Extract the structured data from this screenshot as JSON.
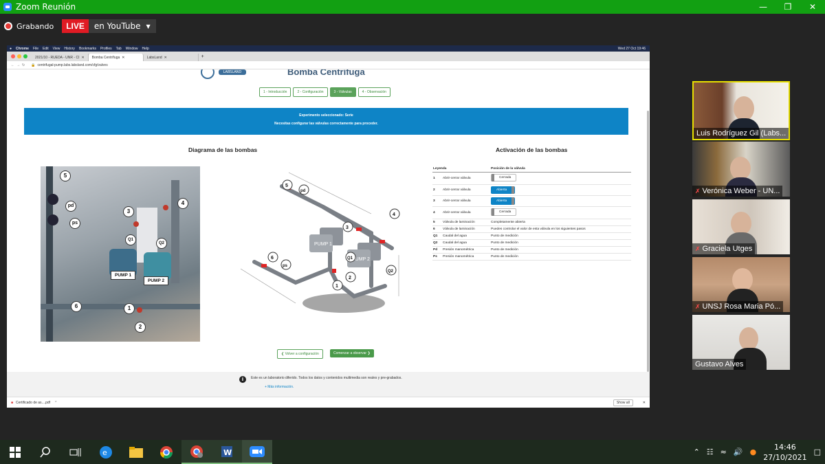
{
  "zoom": {
    "window_title": "Zoom Reunión",
    "recording_label": "Grabando",
    "live_label": "LIVE",
    "stream_target": "en YouTube"
  },
  "shared_screen": {
    "mac_menu": [
      "Chrome",
      "File",
      "Edit",
      "View",
      "History",
      "Bookmarks",
      "Profiles",
      "Tab",
      "Window",
      "Help"
    ],
    "mac_clock": "Wed 27 Oct 19:46",
    "tabs": [
      "2021/10 - RUEDA - UNR - CI",
      "Bomba Centrífuga",
      "LabsLand"
    ],
    "url": "centrifugal-pump.labs.labsland.com/cfg/valves",
    "page_title": "Bomba Centrífuga",
    "logo_badge": "LABSLAND",
    "steps": [
      "1 - Introducción",
      "2 - Configuración",
      "3 - Válvulas",
      "4 - Observación"
    ],
    "banner": {
      "line1": "Experimento seleccionado: Serie",
      "line2": "Necesitas configurar las válvulas correctamente para proceder."
    },
    "diagram_title": "Diagrama de las bombas",
    "activation_title": "Activación de las bombas",
    "photo_labels": {
      "n1": "1",
      "n2": "2",
      "n3": "3",
      "n4": "4",
      "n5": "5",
      "n6": "6",
      "pd": "pd",
      "ps": "ps",
      "q1": "Q1",
      "q2": "Q2",
      "pump1": "PUMP 1",
      "pump2": "PUMP 2"
    },
    "legend": {
      "col1": "Leyenda",
      "col2": "Posición de la válvula",
      "rows": [
        {
          "key": "1",
          "name": "Abrir-cerrar válvula",
          "value": "Cerrada",
          "type": "valve",
          "open": false
        },
        {
          "key": "2",
          "name": "Abrir-cerrar válvula",
          "value": "Abierta",
          "type": "valve",
          "open": true
        },
        {
          "key": "3",
          "name": "Abrir-cerrar válvula",
          "value": "Abierta",
          "type": "valve",
          "open": true
        },
        {
          "key": "4",
          "name": "Abrir-cerrar válvula",
          "value": "Cerrada",
          "type": "valve",
          "open": false
        },
        {
          "key": "5",
          "name": "Válvula de laminación",
          "value": "Completamente abierta",
          "type": "text"
        },
        {
          "key": "6",
          "name": "Válvula de laminación",
          "value": "Puedes controlar el valor de esta válvula en los siguientes pasos",
          "type": "text"
        },
        {
          "key": "Q1",
          "name": "Caudal del agua",
          "value": "Punto de medición",
          "type": "text"
        },
        {
          "key": "Q2",
          "name": "Caudal del agua",
          "value": "Punto de medición",
          "type": "text"
        },
        {
          "key": "Pd",
          "name": "Presión manométrica",
          "value": "Punto de medición",
          "type": "text"
        },
        {
          "key": "Ps",
          "name": "Presión manométrica",
          "value": "Punto de medición",
          "type": "text"
        }
      ]
    },
    "btn_back": "❮ Volver a configuración",
    "btn_start": "Comenzar a observar ❯",
    "footer_text": "Este es un laboratorio diferido. Todos los datos y contenidos multimedia son reales y pre-grabados.",
    "footer_link": "+ Más información.",
    "download_file": "Certificado de as....pdf",
    "show_all": "Show all"
  },
  "participants": [
    {
      "name": "Luis Rodríguez Gil (Labs...",
      "muted": false,
      "active": true
    },
    {
      "name": "Verónica Weber - UN...",
      "muted": true,
      "active": false
    },
    {
      "name": "Graciela Utges",
      "muted": true,
      "active": false
    },
    {
      "name": "UNSJ  Rosa Maria Pó...",
      "muted": true,
      "active": false
    },
    {
      "name": "Gustavo Alves",
      "muted": false,
      "active": false
    }
  ],
  "taskbar": {
    "time": "14:46",
    "date": "27/10/2021"
  }
}
